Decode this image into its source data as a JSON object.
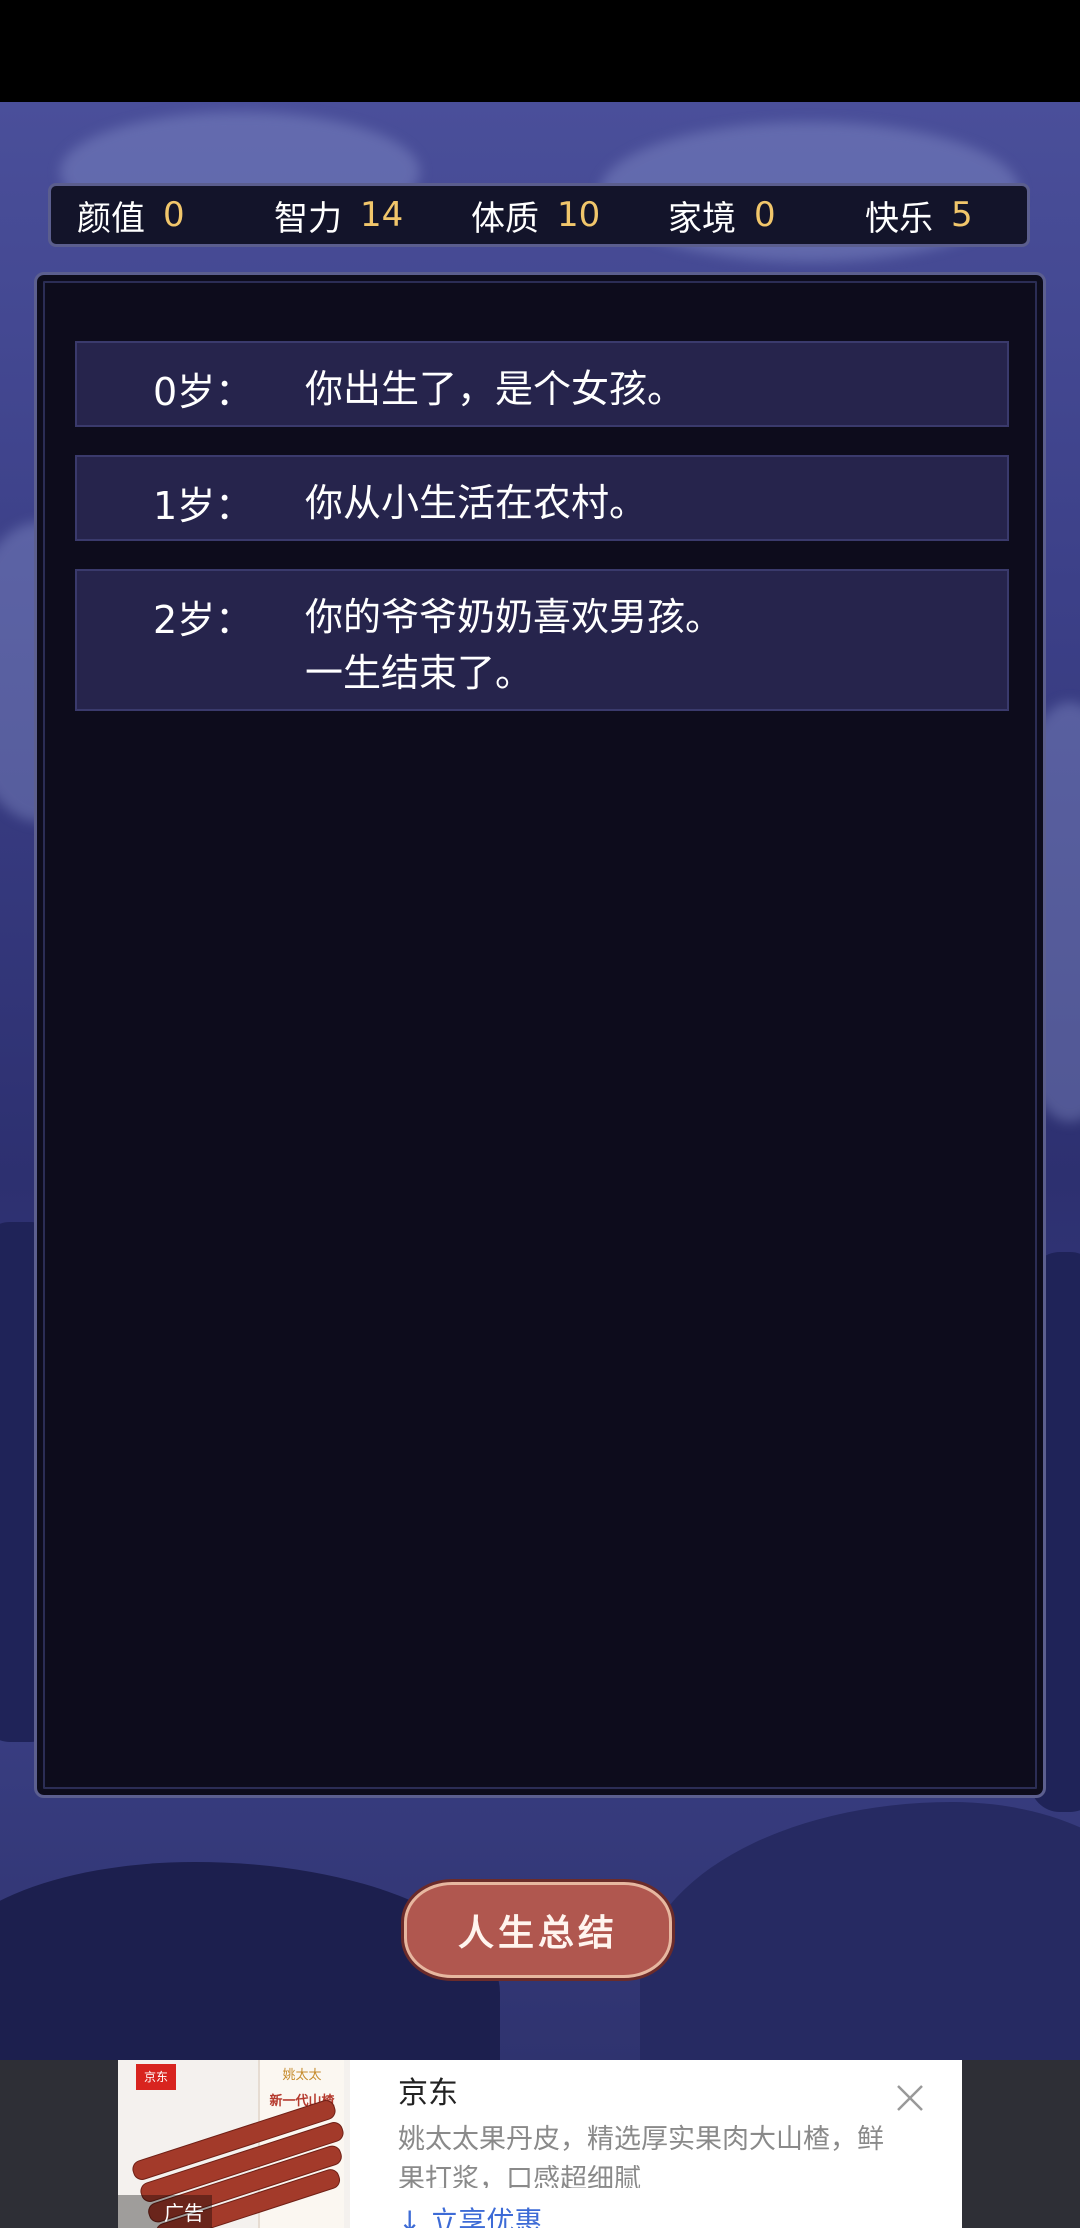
{
  "stats": [
    {
      "name": "颜值",
      "value": "0"
    },
    {
      "name": "智力",
      "value": "14"
    },
    {
      "name": "体质",
      "value": "10"
    },
    {
      "name": "家境",
      "value": "0"
    },
    {
      "name": "快乐",
      "value": "5"
    }
  ],
  "log": [
    {
      "age": "0岁：",
      "events": [
        "你出生了，是个女孩。"
      ]
    },
    {
      "age": "1岁：",
      "events": [
        "你从小生活在农村。"
      ]
    },
    {
      "age": "2岁：",
      "events": [
        "你的爷爷奶奶喜欢男孩。",
        "一生结束了。"
      ]
    }
  ],
  "summary_button": "人生总结",
  "ad": {
    "logo_text": "京东",
    "pack_brand": "姚太太",
    "pack_title": "新一代山楂",
    "badge": "广告",
    "title": "京东",
    "description": "姚太太果丹皮，精选厚实果肉大山楂，鲜果打浆，口感超细腻",
    "cta": "↓ 立享优惠"
  },
  "colors": {
    "stat_value": "#f1c66b",
    "panel_bg": "#0d0c1c",
    "entry_bg": "#26244c",
    "button_bg": "#b0574f"
  }
}
